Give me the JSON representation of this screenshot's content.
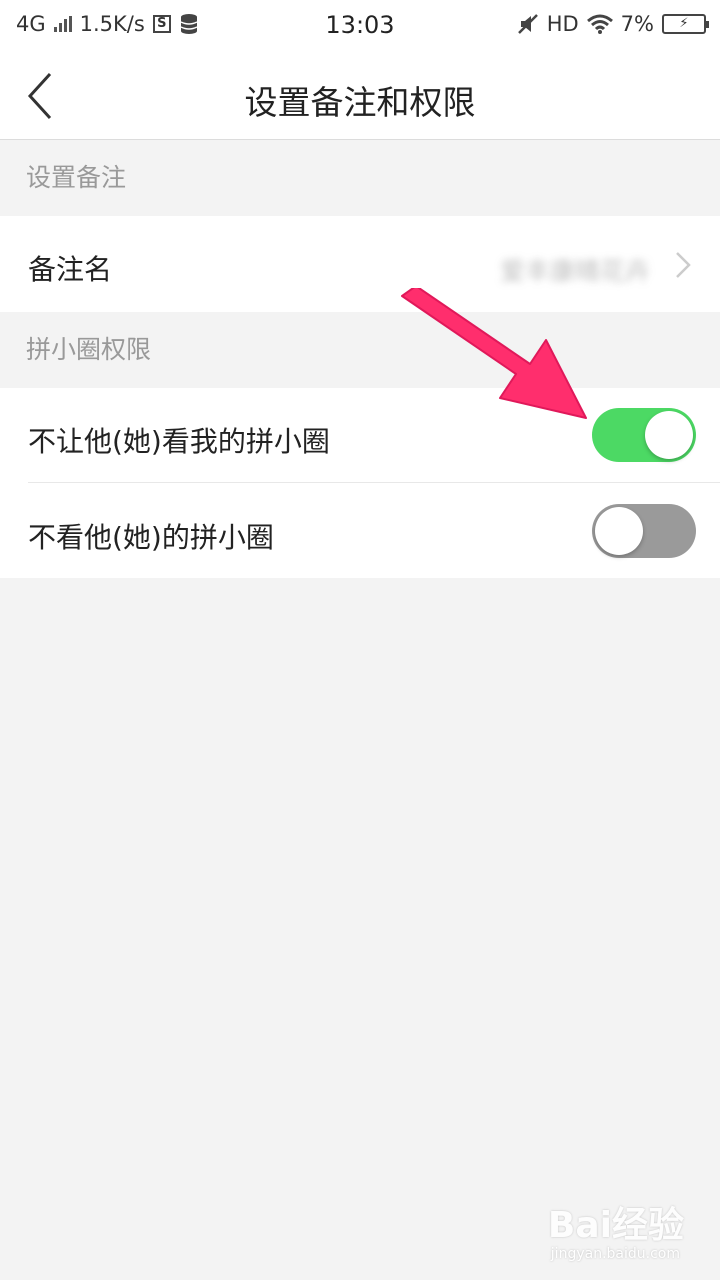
{
  "status_bar": {
    "network": "4G",
    "speed": "1.5K/s",
    "s_badge": "S",
    "time": "13:03",
    "hd": "HD",
    "battery_percent": "7%"
  },
  "nav": {
    "title": "设置备注和权限",
    "back_icon": "chevron-left-icon"
  },
  "remark_section": {
    "header": "设置备注",
    "remark_label": "备注名",
    "remark_value": "爱丰康晴花卉"
  },
  "permission_section": {
    "header": "拼小圈权限",
    "items": [
      {
        "label": "不让他(她)看我的拼小圈",
        "enabled": true
      },
      {
        "label": "不看他(她)的拼小圈",
        "enabled": false
      }
    ]
  },
  "annotation": {
    "arrow_color": "#ff2e6d"
  },
  "colors": {
    "switch_on": "#4cd964",
    "switch_off": "#9a9a9a",
    "background": "#f3f3f3"
  },
  "watermark": {
    "brand": "Bai经验",
    "url": "jingyan.baidu.com"
  }
}
